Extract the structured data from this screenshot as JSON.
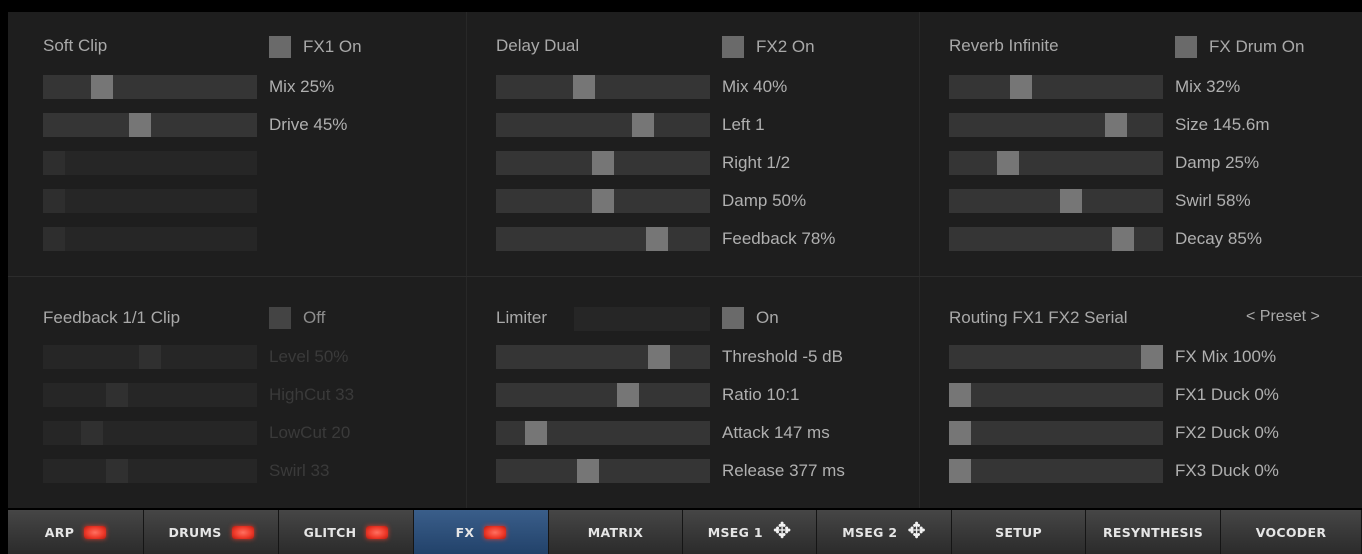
{
  "fx1": {
    "title": "Soft Clip",
    "toggle_label": "FX1 On",
    "params": [
      {
        "label": "Mix 25%",
        "value": 0.25
      },
      {
        "label": "Drive 45%",
        "value": 0.45
      }
    ],
    "empty_slots": 3
  },
  "fx2": {
    "title": "Delay Dual",
    "toggle_label": "FX2 On",
    "params": [
      {
        "label": "Mix 40%",
        "value": 0.4
      },
      {
        "label": "Left 1",
        "value": 0.71
      },
      {
        "label": "Right 1/2",
        "value": 0.5
      },
      {
        "label": "Damp 50%",
        "value": 0.5
      },
      {
        "label": "Feedback 78%",
        "value": 0.78
      }
    ]
  },
  "fx_drum": {
    "title": "Reverb Infinite",
    "toggle_label": "FX Drum On",
    "params": [
      {
        "label": "Mix 32%",
        "value": 0.32
      },
      {
        "label": "Size 145.6m",
        "value": 0.81
      },
      {
        "label": "Damp 25%",
        "value": 0.25
      },
      {
        "label": "Swirl 58%",
        "value": 0.58
      },
      {
        "label": "Decay 85%",
        "value": 0.85
      }
    ]
  },
  "feedback": {
    "title": "Feedback 1/1 Clip",
    "toggle_label": "Off",
    "params": [
      {
        "label": "Level 50%",
        "value": 0.5
      },
      {
        "label": "HighCut 33",
        "value": 0.33
      },
      {
        "label": "LowCut 20",
        "value": 0.2
      },
      {
        "label": "Swirl 33",
        "value": 0.33
      }
    ]
  },
  "limiter": {
    "title": "Limiter",
    "toggle_label": "On",
    "params": [
      {
        "label": "Threshold -5 dB",
        "value": 0.79
      },
      {
        "label": "Ratio 10:1",
        "value": 0.63
      },
      {
        "label": "Attack 147 ms",
        "value": 0.15
      },
      {
        "label": "Release 377 ms",
        "value": 0.42
      }
    ]
  },
  "routing": {
    "title": "Routing FX1 FX2 Serial",
    "preset_label": "< Preset >",
    "params": [
      {
        "label": "FX Mix 100%",
        "value": 1.0
      },
      {
        "label": "FX1 Duck 0%",
        "value": 0.0
      },
      {
        "label": "FX2 Duck 0%",
        "value": 0.0
      },
      {
        "label": "FX3 Duck 0%",
        "value": 0.0
      }
    ]
  },
  "tabs": [
    {
      "label": "ARP",
      "indicator": "led"
    },
    {
      "label": "DRUMS",
      "indicator": "led"
    },
    {
      "label": "GLITCH",
      "indicator": "led"
    },
    {
      "label": "FX",
      "indicator": "led",
      "active": true
    },
    {
      "label": "MATRIX",
      "indicator": "none"
    },
    {
      "label": "MSEG 1",
      "indicator": "move-icon"
    },
    {
      "label": "MSEG 2",
      "indicator": "move-icon"
    },
    {
      "label": "SETUP",
      "indicator": "none"
    },
    {
      "label": "RESYNTHESIS",
      "indicator": "none"
    },
    {
      "label": "VOCODER",
      "indicator": "none"
    }
  ],
  "colors": {
    "panel_bg": "#1e1e1e",
    "slider_track": "#353535",
    "slider_knob": "#767676",
    "text": "#b0b0b0",
    "active_tab": "#2d5080",
    "led": "#f03a2a"
  }
}
